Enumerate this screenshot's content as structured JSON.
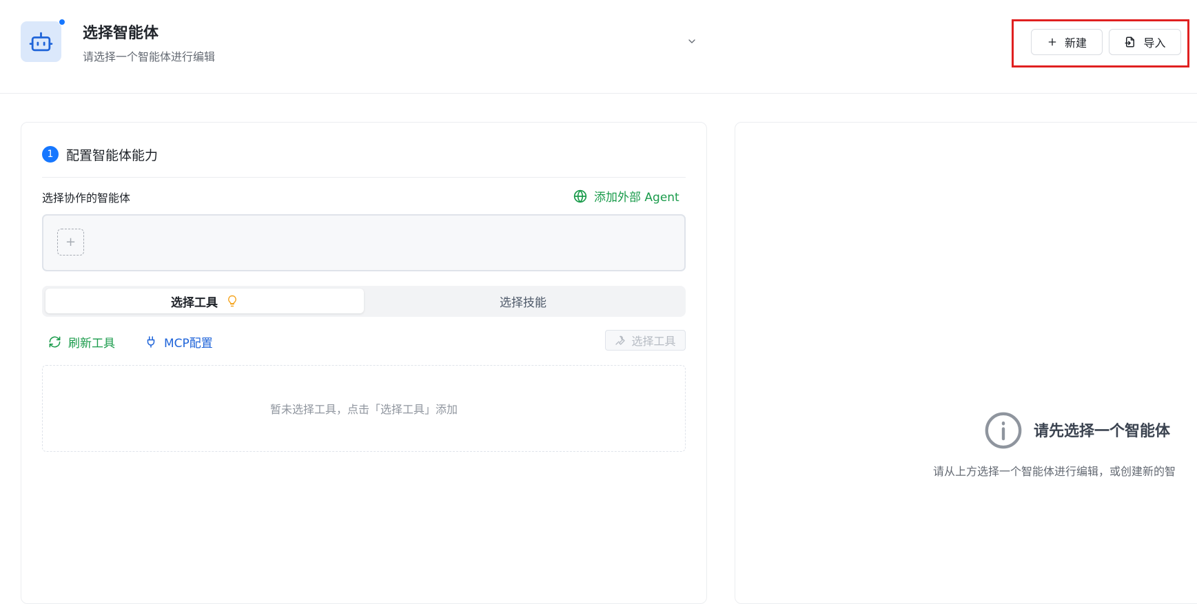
{
  "header": {
    "title": "选择智能体",
    "subtitle": "请选择一个智能体进行编辑",
    "new_label": "新建",
    "import_label": "导入"
  },
  "config": {
    "step_number": "1",
    "section_title": "配置智能体能力",
    "collab_label": "选择协作的智能体",
    "add_external_label": "添加外部 Agent",
    "add_slot_symbol": "+",
    "tabs": [
      {
        "label": "选择工具",
        "active": true
      },
      {
        "label": "选择技能",
        "active": false
      }
    ],
    "refresh_label": "刷新工具",
    "mcp_label": "MCP配置",
    "select_tools_label": "选择工具",
    "empty_tools_text": "暂未选择工具，点击「选择工具」添加"
  },
  "right_panel": {
    "empty_title": "请先选择一个智能体",
    "empty_desc": "请从上方选择一个智能体进行编辑，或创建新的智"
  },
  "colors": {
    "accent_blue": "#1677ff",
    "link_green": "#1a9b4b",
    "mcp_blue": "#1f64d9",
    "highlight_red": "#e02020"
  },
  "icons": [
    "robot-icon",
    "chevron-down-icon",
    "plus-icon",
    "import-icon",
    "globe-icon",
    "lightbulb-icon",
    "refresh-icon",
    "plug-icon",
    "wrench-icon",
    "info-icon"
  ]
}
